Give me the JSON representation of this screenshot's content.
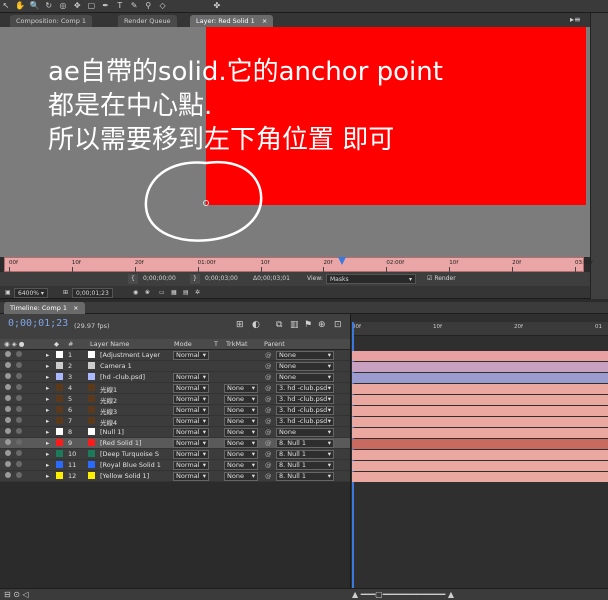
{
  "tabs": {
    "composition": "Composition: Comp 1",
    "render_queue": "Render Queue",
    "layer": "Layer: Red Solid 1"
  },
  "note": {
    "line1": "ae自帶的solid.它的anchor point",
    "line2": "都是在中心點.",
    "line3": "所以需要移到左下角位置 即可"
  },
  "ruler": {
    "labels": [
      "00f",
      "10f",
      "20f",
      "01:00f",
      "10f",
      "20f",
      "02:00f",
      "10f",
      "20f",
      "03:00f"
    ]
  },
  "layer_controls": {
    "start": "0;00;00;00",
    "end": "0;00;03;00",
    "duration": "Δ0;00;03;01",
    "view_label": "View:",
    "view_value": "Masks",
    "render_label": "Render"
  },
  "viewer_footer": {
    "zoom": "6400%",
    "timecode": "0;00;01;23"
  },
  "timeline": {
    "tab": "Timeline: Comp 1",
    "timecode": "0;00;01;23",
    "fps": "(29.97 fps)",
    "ruler_labels": [
      "00f",
      "10f",
      "20f",
      "01"
    ]
  },
  "columns": {
    "num": "#",
    "name": "Layer Name",
    "mode": "Mode",
    "t": "T",
    "trkmat": "TrkMat",
    "parent": "Parent"
  },
  "layers": [
    {
      "num": "1",
      "name": "[Adjustment Layer",
      "mode": "Normal",
      "trkmat": "",
      "parent": "None",
      "color": "#ffffff",
      "bar": "#e8a0a0"
    },
    {
      "num": "2",
      "name": "Camera 1",
      "mode": "",
      "trkmat": "",
      "parent": "None",
      "color": "#cccccc",
      "bar": "#c8a0c0"
    },
    {
      "num": "3",
      "name": "[hd -club.psd]",
      "mode": "Normal",
      "trkmat": "",
      "parent": "None",
      "color": "#a9b8ff",
      "bar": "#9b9bd0"
    },
    {
      "num": "4",
      "name": "光線1",
      "mode": "Normal",
      "trkmat": "None",
      "parent": "3. hd -club.psd",
      "color": "#5a3a1a",
      "bar": "#eaa8a0"
    },
    {
      "num": "5",
      "name": "光線2",
      "mode": "Normal",
      "trkmat": "None",
      "parent": "3. hd -club.psd",
      "color": "#5a3a1a",
      "bar": "#eaa8a0"
    },
    {
      "num": "6",
      "name": "光線3",
      "mode": "Normal",
      "trkmat": "None",
      "parent": "3. hd -club.psd",
      "color": "#5a3a1a",
      "bar": "#eaa8a0"
    },
    {
      "num": "7",
      "name": "光線4",
      "mode": "Normal",
      "trkmat": "None",
      "parent": "3. hd -club.psd",
      "color": "#5a3a1a",
      "bar": "#eaa8a0"
    },
    {
      "num": "8",
      "name": "[Null 1]",
      "mode": "Normal",
      "trkmat": "None",
      "parent": "None",
      "color": "#ffffff",
      "bar": "#eaa8a0"
    },
    {
      "num": "9",
      "name": "[Red Solid 1]",
      "mode": "Normal",
      "trkmat": "None",
      "parent": "8. Null 1",
      "color": "#ff1a1a",
      "bar": "#c86a60"
    },
    {
      "num": "10",
      "name": "[Deep Turquoise S",
      "mode": "Normal",
      "trkmat": "None",
      "parent": "8. Null 1",
      "color": "#1a7a5a",
      "bar": "#eaa8a0"
    },
    {
      "num": "11",
      "name": "[Royal Blue Solid 1",
      "mode": "Normal",
      "trkmat": "None",
      "parent": "8. Null 1",
      "color": "#2a6aff",
      "bar": "#eaa8a0"
    },
    {
      "num": "12",
      "name": "[Yellow Solid 1]",
      "mode": "Normal",
      "trkmat": "None",
      "parent": "8. Null 1",
      "color": "#ffee00",
      "bar": "#eaa8a0"
    }
  ]
}
